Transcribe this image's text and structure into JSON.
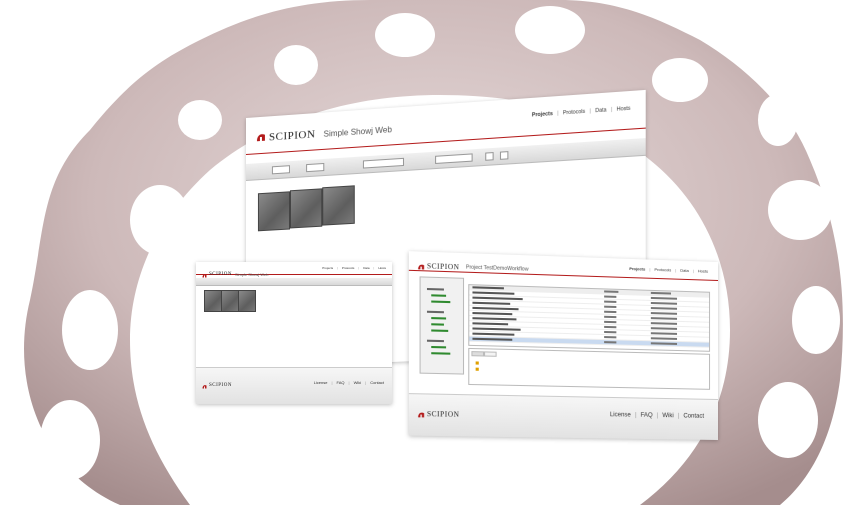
{
  "colors": {
    "accent": "#b31b1b",
    "background_shape": "#d4c4c4"
  },
  "logo": {
    "icon": "scipion-helmet-icon",
    "text": "SCIPION"
  },
  "main_window": {
    "subtitle": "Simple Showj Web",
    "nav": [
      "Projects",
      "Protocols",
      "Data",
      "Hosts"
    ]
  },
  "left_window": {
    "subtitle": "Simple Showj Web",
    "nav": [
      "Projects",
      "Protocols",
      "Data",
      "Hosts"
    ],
    "footer_links": [
      "License",
      "FAQ",
      "Wiki",
      "Contact"
    ]
  },
  "right_window": {
    "subtitle": "Project TestDemoWorkflow",
    "nav": [
      "Projects",
      "Protocols",
      "Data",
      "Hosts"
    ],
    "footer_links": [
      "License",
      "FAQ",
      "Wiki",
      "Contact"
    ]
  }
}
